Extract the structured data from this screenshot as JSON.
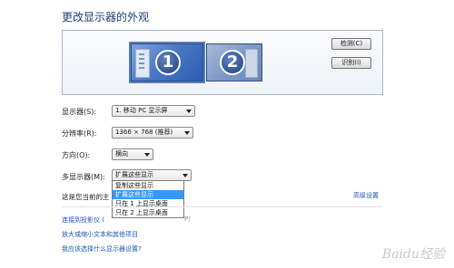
{
  "window": {
    "title": "更改显示器的外观"
  },
  "preview": {
    "monitors": [
      {
        "number": "1",
        "selected": true
      },
      {
        "number": "2",
        "selected": false
      }
    ],
    "detect_label": "检测(C)",
    "identify_label": "识别(I)"
  },
  "settings": {
    "display_label": "显示器(S):",
    "display_value": "1. 移动 PC 显示屏",
    "resolution_label": "分辨率(R):",
    "resolution_value": "1366 × 768 (推荐)",
    "orientation_label": "方向(O):",
    "orientation_value": "横向",
    "multi_label": "多显示器(M):",
    "multi_value": "扩展这些显示",
    "multi_options": [
      "复制这些显示",
      "扩展这些显示",
      "只在 1 上显示桌面",
      "只在 2 上显示桌面"
    ],
    "multi_selected_index": 1
  },
  "footer": {
    "main_display_text": "这是您当前的主",
    "advanced_link": "高级设置",
    "projector_link": "连接到投影仪 (",
    "projector_suffix": "P)",
    "enlarge_link": "放大或缩小文本和其他项目",
    "help_link": "我应该选择什么显示器设置?"
  },
  "watermark": "Baidu经验"
}
